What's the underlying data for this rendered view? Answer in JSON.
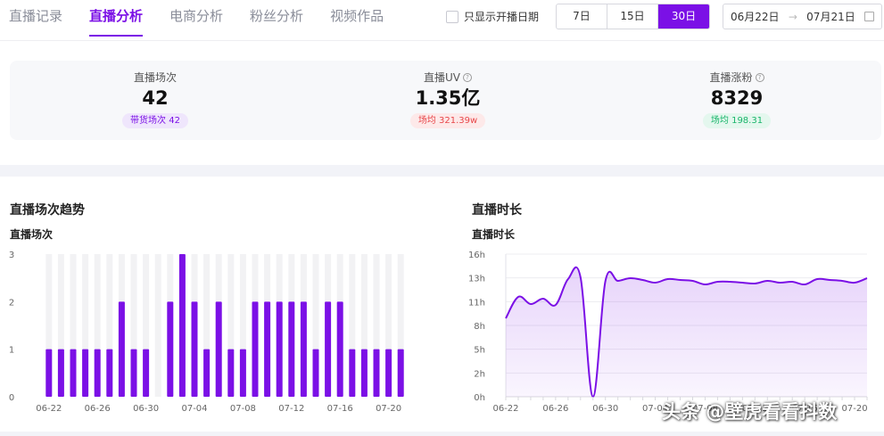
{
  "nav": {
    "tabs": [
      {
        "label": "直播记录",
        "active": false
      },
      {
        "label": "直播分析",
        "active": true
      },
      {
        "label": "电商分析",
        "active": false
      },
      {
        "label": "粉丝分析",
        "active": false
      },
      {
        "label": "视频作品",
        "active": false
      }
    ],
    "checkbox_label": "只显示开播日期",
    "ranges": [
      "7日",
      "15日",
      "30日"
    ],
    "active_range": "30日",
    "date_start": "06月22日",
    "date_end": "07月21日",
    "accent_color": "#7b10e6"
  },
  "kpis": [
    {
      "label": "直播场次",
      "value": "42",
      "badge": "带货场次 42",
      "help": false
    },
    {
      "label": "直播UV",
      "value": "1.35亿",
      "badge": "场均 321.39w",
      "help": true
    },
    {
      "label": "直播涨粉",
      "value": "8329",
      "badge": "场均 198.31",
      "help": true
    }
  ],
  "charts": {
    "sessions_title": "直播场次趋势",
    "duration_title": "直播时长"
  },
  "chart_data": [
    {
      "type": "bar",
      "ylabel": "直播场次",
      "ylim": [
        0,
        3
      ],
      "yticks": [
        "0",
        "1",
        "2",
        "3"
      ],
      "categories": [
        "06-22",
        "06-23",
        "06-24",
        "06-25",
        "06-26",
        "06-27",
        "06-28",
        "06-29",
        "06-30",
        "07-01",
        "07-02",
        "07-03",
        "07-04",
        "07-05",
        "07-06",
        "07-07",
        "07-08",
        "07-09",
        "07-10",
        "07-11",
        "07-12",
        "07-13",
        "07-14",
        "07-15",
        "07-16",
        "07-17",
        "07-18",
        "07-19",
        "07-20",
        "07-21"
      ],
      "xtick_labels": [
        "06-22",
        "06-26",
        "06-30",
        "07-04",
        "07-08",
        "07-12",
        "07-16",
        "07-20"
      ],
      "values": [
        1,
        1,
        1,
        1,
        1,
        1,
        2,
        1,
        1,
        0,
        2,
        3,
        2,
        1,
        2,
        1,
        1,
        2,
        2,
        2,
        2,
        2,
        1,
        2,
        2,
        1,
        1,
        1,
        1,
        1
      ],
      "color": "#7b10e6",
      "background_color": "#f2f2f4"
    },
    {
      "type": "area",
      "ylabel": "直播时长",
      "ylim": [
        0,
        16
      ],
      "yticks": [
        "0h",
        "2h",
        "5h",
        "8h",
        "11h",
        "13h",
        "16h"
      ],
      "x": [
        "06-22",
        "06-23",
        "06-24",
        "06-25",
        "06-26",
        "06-27",
        "06-28",
        "06-29",
        "06-30",
        "07-01",
        "07-02",
        "07-03",
        "07-04",
        "07-05",
        "07-06",
        "07-07",
        "07-08",
        "07-09",
        "07-10",
        "07-11",
        "07-12",
        "07-13",
        "07-14",
        "07-15",
        "07-16",
        "07-17",
        "07-18",
        "07-19",
        "07-20",
        "07-21"
      ],
      "xtick_labels": [
        "06-22",
        "06-26",
        "06-30",
        "07-04",
        "07-08",
        "07-12",
        "07-16",
        "07-20"
      ],
      "values": [
        8.8,
        11.2,
        10.4,
        11.0,
        10.3,
        13.2,
        13.4,
        0.0,
        13.0,
        13.0,
        13.3,
        13.1,
        12.8,
        13.2,
        13.1,
        13.0,
        12.6,
        12.9,
        12.9,
        12.8,
        12.7,
        13.0,
        12.8,
        12.9,
        12.6,
        13.2,
        13.1,
        13.0,
        12.8,
        13.3
      ],
      "color": "#7b10e6"
    }
  ],
  "watermark": "头条 @壁虎看看抖数"
}
